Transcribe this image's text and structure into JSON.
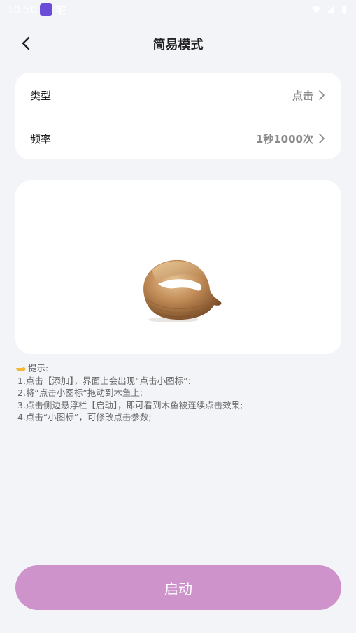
{
  "status_bar": {
    "time": "10:50",
    "extra": "宅"
  },
  "nav": {
    "title": "简易模式"
  },
  "settings": {
    "type_label": "类型",
    "type_value": "点击",
    "frequency_label": "频率",
    "frequency_value": "1秒1000次"
  },
  "tips": {
    "title": "提示:",
    "lines": [
      "1.点击【添加】，界面上会出现“点击小图标”:",
      "2.将“点击小图标”拖动到木鱼上;",
      "3.点击侧边悬浮栏【启动】，即可看到木鱼被连续点击效果;",
      "4.点击“小图标”，可修改点击参数;"
    ]
  },
  "start_button": {
    "label": "启动"
  },
  "colors": {
    "background": "#f3f4f8",
    "card": "#ffffff",
    "button": "#cf93cc",
    "status_app_icon": "#6a4cd8"
  },
  "icons": {
    "back": "chevron-left-icon",
    "chevron": "chevron-right-icon",
    "tip_marker": "pointing-hand-icon",
    "image": "wooden-fish"
  }
}
